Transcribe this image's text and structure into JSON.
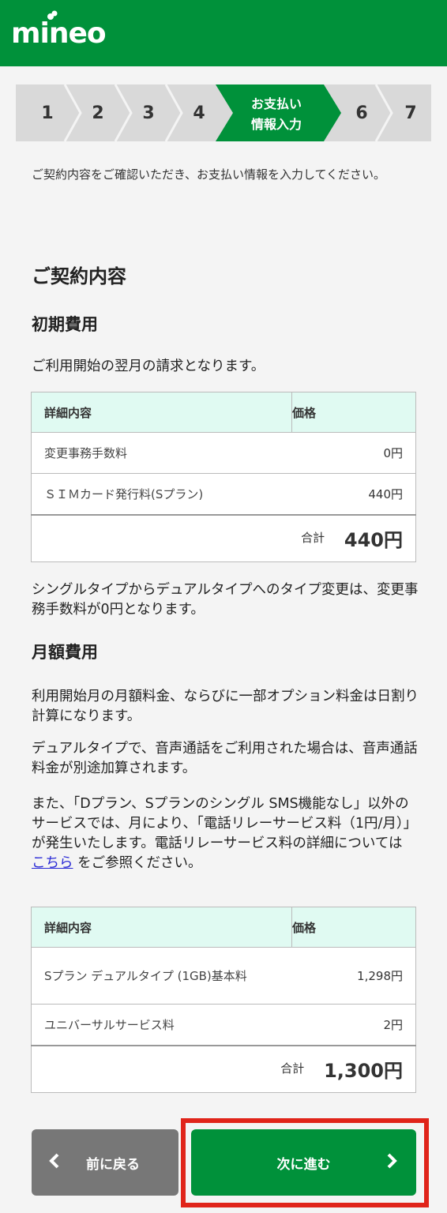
{
  "header": {
    "logo": "mineo"
  },
  "stepper": {
    "steps": [
      "1",
      "2",
      "3",
      "4",
      "",
      "6",
      "7"
    ],
    "active_label_line1": "お支払い",
    "active_label_line2": "情報入力"
  },
  "intro": "ご契約内容をご確認いただき、お支払い情報を入力してください。",
  "contract": {
    "title": "ご契約内容",
    "initial": {
      "title": "初期費用",
      "note": "ご利用開始の翌月の請求となります。",
      "header_item": "詳細内容",
      "header_price": "価格",
      "rows": [
        {
          "item": "変更事務手数料",
          "price": "0円"
        },
        {
          "item": "ＳＩＭカード発行料(Sプラン)",
          "price": "440円"
        }
      ],
      "total_label": "合計",
      "total_amount": "440円",
      "after_note": "シングルタイプからデュアルタイプへのタイプ変更は、変更事務手数料が0円となります。"
    },
    "monthly": {
      "title": "月額費用",
      "note1": "利用開始月の月額料金、ならびに一部オプション料金は日割り計算になります。",
      "note2": "デュアルタイプで、音声通話をご利用された場合は、音声通話料金が別途加算されます。",
      "note3_before": "また、「Dプラン、Sプランのシングル SMS機能なし」以外のサービスでは、月により、「電話リレーサービス料（1円/月）」が発生いたします。電話リレーサービス料の詳細については ",
      "note3_link": "こちら",
      "note3_after": " をご参照ください。",
      "header_item": "詳細内容",
      "header_price": "価格",
      "rows": [
        {
          "item": "Sプラン デュアルタイプ (1GB)基本料",
          "price": "1,298円"
        },
        {
          "item": "ユニバーサルサービス料",
          "price": "2円"
        }
      ],
      "total_label": "合計",
      "total_amount": "1,300円"
    }
  },
  "buttons": {
    "back": "前に戻る",
    "next": "次に進む"
  },
  "colors": {
    "brand": "#00913a",
    "highlight": "#e0241a",
    "table_header": "#e0faf2"
  }
}
